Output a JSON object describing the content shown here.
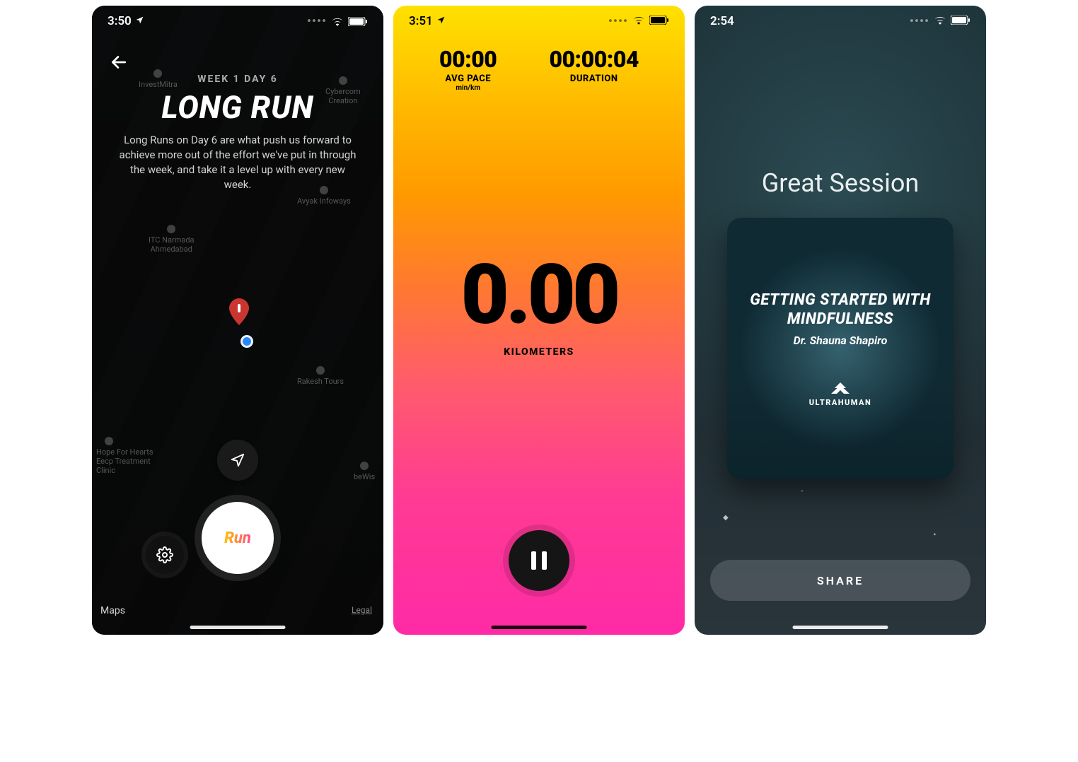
{
  "screen1": {
    "status_time": "3:50",
    "week_day": "WEEK 1 DAY 6",
    "title": "LONG RUN",
    "description": "Long Runs on Day 6 are what push us forward to achieve more out of the effort we've put in through the week, and take it a level up with every new week.",
    "run_label": "Run",
    "map_credit": "Maps",
    "legal": "Legal",
    "poi": {
      "itc": "ITC Narmada\nAhmedabad",
      "rakesh": "Rakesh Tours",
      "hope": "Hope For Hearts\nEecp Treatment\nClinic",
      "bewise": "beWis",
      "avyak": "Avyak Infoways",
      "cybercom": "Cybercom\nCreation",
      "investmitra": "InvestMitra"
    }
  },
  "screen2": {
    "status_time": "3:51",
    "pace_value": "00:00",
    "pace_label": "AVG PACE",
    "pace_unit": "min/km",
    "duration_value": "00:00:04",
    "duration_label": "DURATION",
    "distance_value": "0.00",
    "distance_label": "KILOMETERS"
  },
  "screen3": {
    "status_time": "2:54",
    "heading": "Great Session",
    "session_title": "GETTING STARTED WITH MINDFULNESS",
    "author": "Dr. Shauna Shapiro",
    "brand": "ULTRAHUMAN",
    "share_label": "SHARE"
  }
}
